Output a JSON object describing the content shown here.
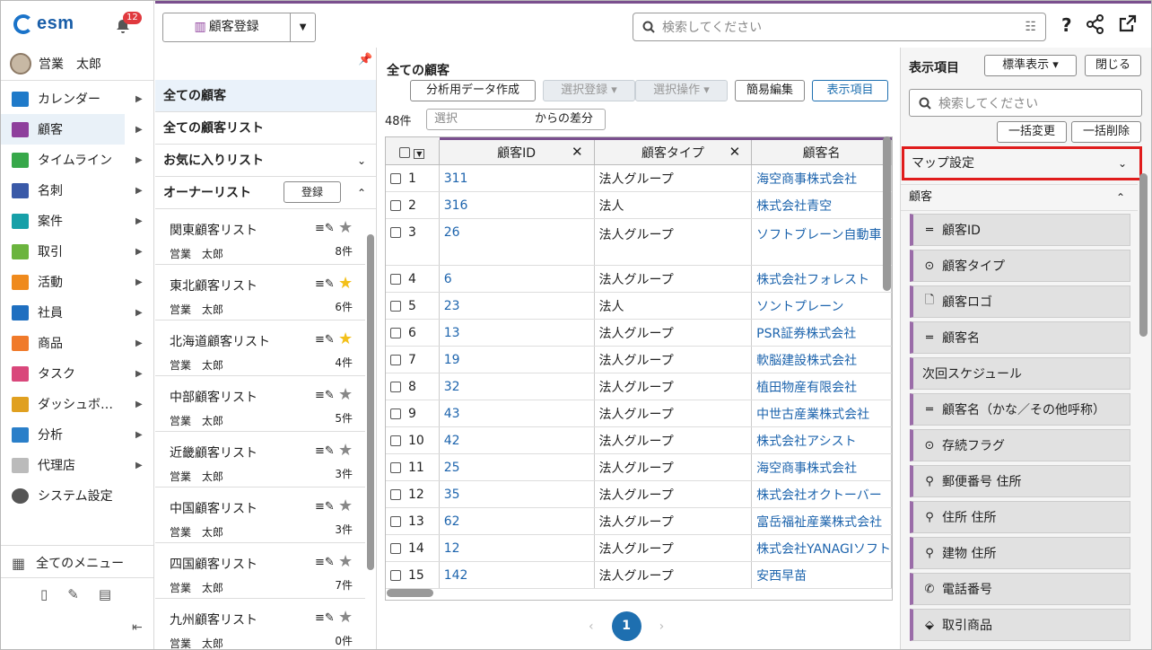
{
  "app": {
    "logo": "esm",
    "notification_count": "12"
  },
  "user": {
    "name": "営業　太郎"
  },
  "nav": {
    "items": [
      {
        "label": "カレンダー",
        "icon": "calendar-icon",
        "color": "#1f7ac9"
      },
      {
        "label": "顧客",
        "icon": "customer-building-icon",
        "color": "#8e3f9c"
      },
      {
        "label": "タイムライン",
        "icon": "timeline-icon",
        "color": "#37a84a"
      },
      {
        "label": "名刺",
        "icon": "business-card-icon",
        "color": "#3a5aa8"
      },
      {
        "label": "案件",
        "icon": "folder-icon",
        "color": "#17a0a8"
      },
      {
        "label": "取引",
        "icon": "deal-icon",
        "color": "#6bb43e"
      },
      {
        "label": "活動",
        "icon": "clipboard-icon",
        "color": "#ef8a1d"
      },
      {
        "label": "社員",
        "icon": "person-icon",
        "color": "#1f6fc0"
      },
      {
        "label": "商品",
        "icon": "product-box-icon",
        "color": "#f07a2a"
      },
      {
        "label": "タスク",
        "icon": "task-check-icon",
        "color": "#d9477b"
      },
      {
        "label": "ダッシュボ…",
        "icon": "dashboard-icon",
        "color": "#e0a020"
      },
      {
        "label": "分析",
        "icon": "analysis-chart-icon",
        "color": "#2a7fc9"
      },
      {
        "label": "代理店",
        "icon": "agency-doc-icon",
        "color": "#bbbbbb"
      },
      {
        "label": "システム設定",
        "icon": "gear-icon",
        "color": "#555555"
      }
    ],
    "all_menu": "全てのメニュー"
  },
  "topbar": {
    "register_label": "顧客登録",
    "search_placeholder": "検索してください"
  },
  "lists": {
    "all_customers": "全ての顧客",
    "all_lists": "全ての顧客リスト",
    "favorites": "お気に入りリスト",
    "owner_lists": "オーナーリスト",
    "register_button": "登録",
    "items": [
      {
        "name": "関東顧客リスト",
        "owner": "営業　太郎",
        "count": "8件",
        "star": false
      },
      {
        "name": "東北顧客リスト",
        "owner": "営業　太郎",
        "count": "6件",
        "star": true
      },
      {
        "name": "北海道顧客リスト",
        "owner": "営業　太郎",
        "count": "4件",
        "star": true
      },
      {
        "name": "中部顧客リスト",
        "owner": "営業　太郎",
        "count": "5件",
        "star": false
      },
      {
        "name": "近畿顧客リスト",
        "owner": "営業　太郎",
        "count": "3件",
        "star": false
      },
      {
        "name": "中国顧客リスト",
        "owner": "営業　太郎",
        "count": "3件",
        "star": false
      },
      {
        "name": "四国顧客リスト",
        "owner": "営業　太郎",
        "count": "7件",
        "star": false
      },
      {
        "name": "九州顧客リスト",
        "owner": "営業　太郎",
        "count": "0件",
        "star": false
      }
    ]
  },
  "main": {
    "title": "全ての顧客",
    "buttons": {
      "analysis": "分析用データ作成",
      "select_register": "選択登録",
      "select_operation": "選択操作",
      "quick_edit": "簡易編集",
      "display_items": "表示項目"
    },
    "count": "48件",
    "diff_placeholder": "選択",
    "diff_label": "からの差分",
    "columns": [
      "顧客ID",
      "顧客タイプ",
      "顧客名"
    ],
    "rows": [
      {
        "n": "1",
        "id": "311",
        "type": "法人グループ",
        "name": "海空商事株式会社"
      },
      {
        "n": "2",
        "id": "316",
        "type": "法人",
        "name": "株式会社青空"
      },
      {
        "n": "3",
        "id": "26",
        "type": "法人グループ",
        "name": "ソフトブレーン自動車"
      },
      {
        "n": "4",
        "id": "6",
        "type": "法人グループ",
        "name": "株式会社フォレスト"
      },
      {
        "n": "5",
        "id": "23",
        "type": "法人",
        "name": "ソントプレーン"
      },
      {
        "n": "6",
        "id": "13",
        "type": "法人グループ",
        "name": "PSR証券株式会社"
      },
      {
        "n": "7",
        "id": "19",
        "type": "法人グループ",
        "name": "軟脳建設株式会社"
      },
      {
        "n": "8",
        "id": "32",
        "type": "法人グループ",
        "name": "植田物産有限会社"
      },
      {
        "n": "9",
        "id": "43",
        "type": "法人グループ",
        "name": "中世古産業株式会社"
      },
      {
        "n": "10",
        "id": "42",
        "type": "法人グループ",
        "name": "株式会社アシスト"
      },
      {
        "n": "11",
        "id": "25",
        "type": "法人グループ",
        "name": "海空商事株式会社"
      },
      {
        "n": "12",
        "id": "35",
        "type": "法人グループ",
        "name": "株式会社オクトーバー"
      },
      {
        "n": "13",
        "id": "62",
        "type": "法人グループ",
        "name": "富岳福祉産業株式会社"
      },
      {
        "n": "14",
        "id": "12",
        "type": "法人グループ",
        "name": "株式会社YANAGIソフト"
      },
      {
        "n": "15",
        "id": "142",
        "type": "法人グループ",
        "name": "安西早苗"
      }
    ],
    "page": "1"
  },
  "right": {
    "title": "表示項目",
    "preset": "標準表示",
    "close": "閉じる",
    "search_placeholder": "検索してください",
    "bulk_change": "一括変更",
    "bulk_delete": "一括削除",
    "map_settings": "マップ設定",
    "section": "顧客",
    "fields": [
      {
        "label": "顧客ID",
        "glyph": "═"
      },
      {
        "label": "顧客タイプ",
        "glyph": "⊙"
      },
      {
        "label": "顧客ロゴ",
        "glyph": "🗋"
      },
      {
        "label": "顧客名",
        "glyph": "═"
      },
      {
        "label": "次回スケジュール",
        "glyph": ""
      },
      {
        "label": "顧客名（かな／その他呼称）",
        "glyph": "═"
      },
      {
        "label": "存続フラグ",
        "glyph": "⊙"
      },
      {
        "label": "郵便番号  住所",
        "glyph": "⚲"
      },
      {
        "label": "住所  住所",
        "glyph": "⚲"
      },
      {
        "label": "建物  住所",
        "glyph": "⚲"
      },
      {
        "label": "電話番号",
        "glyph": "✆"
      },
      {
        "label": "取引商品",
        "glyph": "⬙"
      }
    ]
  }
}
